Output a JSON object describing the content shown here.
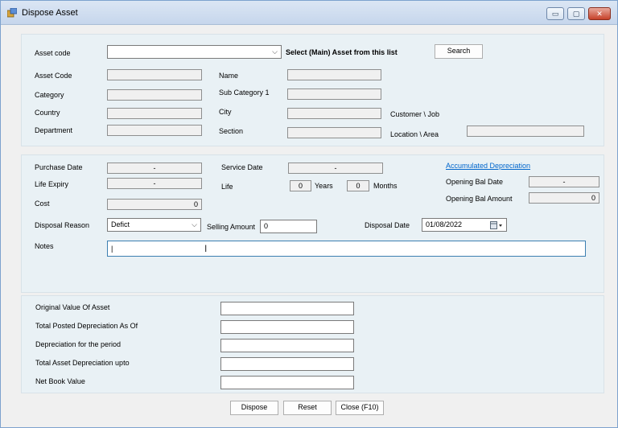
{
  "window": {
    "title": "Dispose Asset",
    "minimize": "▭",
    "maximize": "▢",
    "close": "✕"
  },
  "top": {
    "asset_code_label": "Asset code",
    "asset_code_value": "",
    "select_hint": "Select (Main) Asset from this list",
    "search_label": "Search",
    "asset_code2_label": "Asset Code",
    "name_label": "Name",
    "category_label": "Category",
    "subcategory_label": "Sub Category 1",
    "country_label": "Country",
    "city_label": "City",
    "customer_label": "Customer \\ Job",
    "department_label": "Department",
    "section_label": "Section",
    "location_label": "Location \\ Area"
  },
  "middle": {
    "purchase_date_label": "Purchase Date",
    "purchase_date_value": "-",
    "service_date_label": "Service Date",
    "service_date_value": "-",
    "accumulated_link": "Accumulated Depreciation",
    "life_expiry_label": "Life Expiry",
    "life_expiry_value": "-",
    "life_label": "Life",
    "years_value": "0",
    "years_label": "Years",
    "months_value": "0",
    "months_label": "Months",
    "opening_bal_date_label": "Opening Bal Date",
    "opening_bal_date_value": "-",
    "opening_bal_amount_label": "Opening Bal Amount",
    "opening_bal_amount_value": "0",
    "cost_label": "Cost",
    "cost_value": "0",
    "disposal_reason_label": "Disposal Reason",
    "disposal_reason_value": "Defict",
    "selling_amount_label": "Selling Amount",
    "selling_amount_value": "0",
    "disposal_date_label": "Disposal Date",
    "disposal_date_value": "01/08/2022",
    "notes_label": "Notes",
    "notes_value": "|"
  },
  "bottom": {
    "original_value_label": "Original Value Of Asset",
    "total_posted_label": "Total Posted  Depreciation As Of",
    "period_label": "Depreciation for the period",
    "total_asset_label": "Total Asset Depreciation upto",
    "net_book_label": "Net Book Value"
  },
  "actions": {
    "dispose": "Dispose",
    "reset": "Reset",
    "close": "Close (F10)"
  },
  "colors": {
    "link": "#0066cc",
    "panel": "#e9f1f5",
    "titlebar": "#c6d6ec"
  }
}
